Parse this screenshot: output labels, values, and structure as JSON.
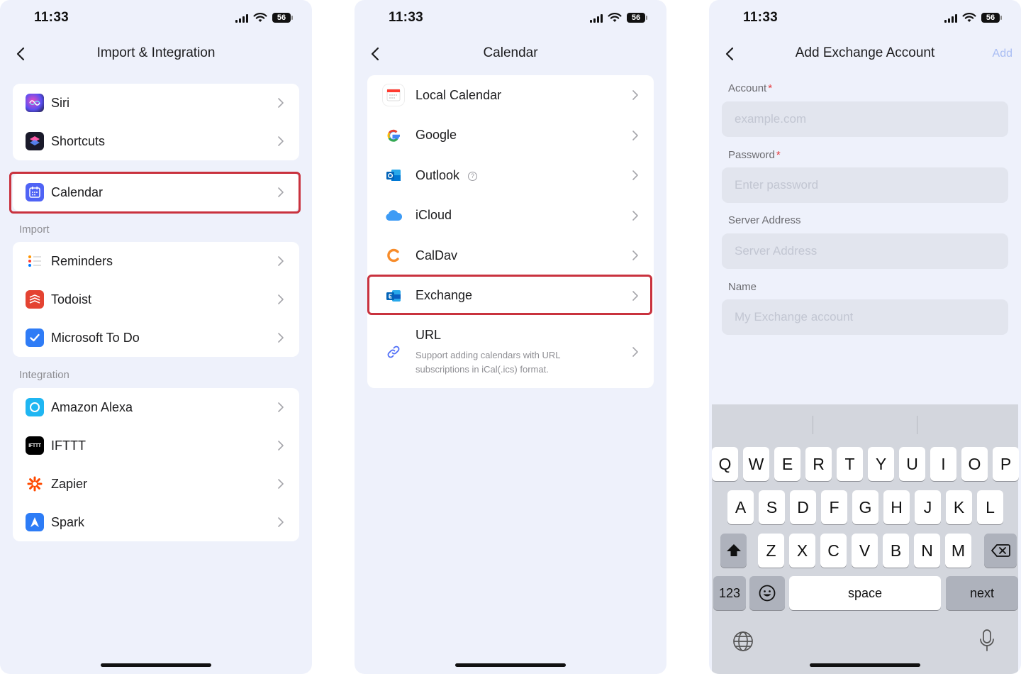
{
  "status_time": "11:33",
  "battery": "56",
  "screen1": {
    "title": "Import & Integration",
    "group1": [
      {
        "label": "Siri",
        "icon": "siri-icon"
      },
      {
        "label": "Shortcuts",
        "icon": "shortcuts-icon"
      }
    ],
    "calendar": {
      "label": "Calendar",
      "icon": "calendar-icon"
    },
    "import_header": "Import",
    "import_items": [
      {
        "label": "Reminders",
        "icon": "reminders-icon"
      },
      {
        "label": "Todoist",
        "icon": "todoist-icon"
      },
      {
        "label": "Microsoft To Do",
        "icon": "microsoft-todo-icon"
      }
    ],
    "integration_header": "Integration",
    "integration_items": [
      {
        "label": "Amazon Alexa",
        "icon": "alexa-icon"
      },
      {
        "label": "IFTTT",
        "icon": "ifttt-icon"
      },
      {
        "label": "Zapier",
        "icon": "zapier-icon"
      },
      {
        "label": "Spark",
        "icon": "spark-icon"
      }
    ],
    "ifttt_logo_text": "IFTTT"
  },
  "screen2": {
    "title": "Calendar",
    "items": [
      {
        "label": "Local Calendar",
        "icon": "local-calendar-icon"
      },
      {
        "label": "Google",
        "icon": "google-icon"
      },
      {
        "label": "Outlook",
        "icon": "outlook-icon"
      },
      {
        "label": "iCloud",
        "icon": "icloud-icon"
      },
      {
        "label": "CalDav",
        "icon": "caldav-icon"
      },
      {
        "label": "Exchange",
        "icon": "exchange-icon"
      }
    ],
    "url": {
      "title": "URL",
      "subtitle": "Support adding calendars with URL subscriptions in iCal(.ics) format.",
      "icon": "link-icon"
    }
  },
  "screen3": {
    "title": "Add Exchange Account",
    "add_label": "Add",
    "fields": [
      {
        "label": "Account",
        "required": true,
        "placeholder": "example.com"
      },
      {
        "label": "Password",
        "required": true,
        "placeholder": "Enter password"
      },
      {
        "label": "Server Address",
        "required": false,
        "placeholder": "Server Address"
      },
      {
        "label": "Name",
        "required": false,
        "placeholder": "My Exchange account"
      }
    ],
    "required_mark": "*"
  },
  "keyboard": {
    "row1": [
      "Q",
      "W",
      "E",
      "R",
      "T",
      "Y",
      "U",
      "I",
      "O",
      "P"
    ],
    "row2": [
      "A",
      "S",
      "D",
      "F",
      "G",
      "H",
      "J",
      "K",
      "L"
    ],
    "row3": [
      "Z",
      "X",
      "C",
      "V",
      "B",
      "N",
      "M"
    ],
    "numbers_key": "123",
    "space_key": "space",
    "next_key": "next"
  },
  "colors": {
    "background": "#eef1fb",
    "highlight": "#c9323e",
    "add_disabled": "#a9bdf3",
    "required": "#e5383b"
  }
}
